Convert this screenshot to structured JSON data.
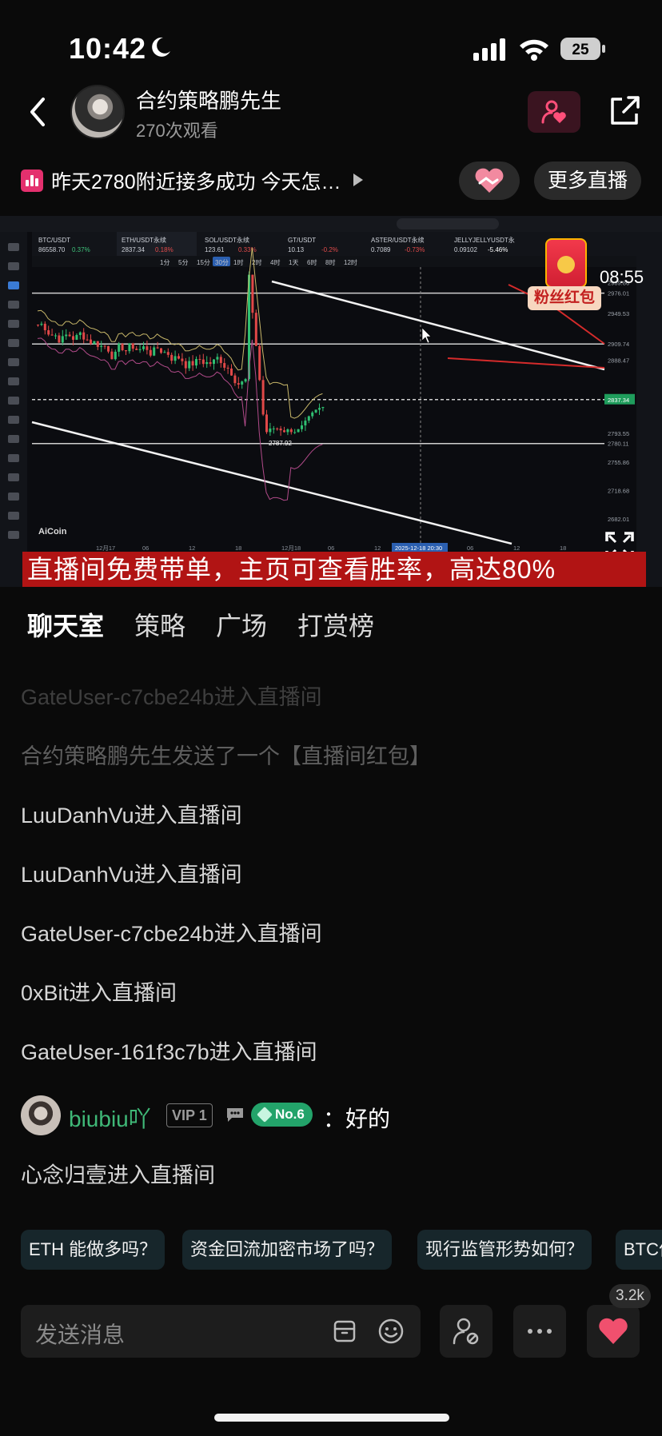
{
  "status_bar": {
    "time": "10:42",
    "battery": "25"
  },
  "header": {
    "host_name": "合约策略鹏先生",
    "viewers": "270次观看"
  },
  "topic": {
    "text": "昨天2780附近接多成功 今天怎…",
    "more_live_label": "更多直播"
  },
  "video": {
    "countdown": "08:55",
    "red_packet_label": "粉丝红包",
    "banner": "直播间免费带单，主页可查看胜率，高达80%",
    "chart_app": "AiCoin",
    "tickers": [
      {
        "symbol": "BTC/USDT",
        "price": "86558.70",
        "change": "0.37%",
        "color": "#3ec27a"
      },
      {
        "symbol": "ETH/USDT永续",
        "price": "2837.34",
        "change": "0.18%",
        "color": "#e24b4b"
      },
      {
        "symbol": "SOL/USDT永续",
        "price": "123.61",
        "change": "0.33%",
        "color": "#e24b4b"
      },
      {
        "symbol": "GT/USDT",
        "price": "10.13",
        "change": "-0.2%",
        "color": "#e24b4b"
      },
      {
        "symbol": "ASTER/USDT永续",
        "price": "0.7089",
        "change": "-0.73%",
        "color": "#e24b4b"
      },
      {
        "symbol": "JELLYJELLYUSDT永",
        "price": "0.09102",
        "change": "-5.46%",
        "color": "#ffffff"
      }
    ],
    "timeframes": [
      "1分",
      "5分",
      "15分",
      "30分",
      "1时",
      "2时",
      "4时",
      "1天",
      "6时",
      "8时",
      "12时"
    ],
    "price_labels": [
      "2989.86",
      "2976.01",
      "2949.53",
      "2909.74",
      "2888.47",
      "2837.34",
      "2793.55",
      "2780.11",
      "2755.86",
      "2718.68",
      "2682.01"
    ],
    "low_label": "2787.92",
    "time_labels": [
      "12月17",
      "06",
      "12",
      "18",
      "12月18",
      "06",
      "12",
      "18",
      "06",
      "12",
      "18"
    ],
    "cursor_time": "2025-12-18 20:30"
  },
  "tabs": [
    "聊天室",
    "策略",
    "广场",
    "打赏榜"
  ],
  "chat": {
    "messages": [
      "GateUser-c7cbe24b进入直播间",
      "合约策略鹏先生发送了一个【直播间红包】",
      "LuuDanhVu进入直播间",
      "LuuDanhVu进入直播间",
      "GateUser-c7cbe24b进入直播间",
      "0xBit进入直播间",
      "GateUser-161f3c7b进入直播间"
    ],
    "user_message": {
      "name": "biubiu吖",
      "vip": "VIP 1",
      "rank": "No.6",
      "text": "：好的"
    },
    "last_message": "心念归壹进入直播间"
  },
  "quick_questions": [
    "ETH 能做多吗？",
    "资金回流加密市场了吗？",
    "现行监管形势如何？",
    "BTC价"
  ],
  "input": {
    "placeholder": "发送消息"
  },
  "likes": "3.2k"
}
